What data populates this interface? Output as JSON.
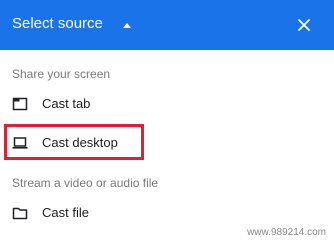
{
  "header": {
    "title": "Select source",
    "toggle_icon": "caret-up-icon",
    "close_icon": "close-icon"
  },
  "sections": [
    {
      "label": "Share your screen",
      "items": [
        {
          "label": "Cast tab",
          "icon": "tab-icon"
        },
        {
          "label": "Cast desktop",
          "icon": "laptop-icon",
          "highlighted": true
        }
      ]
    },
    {
      "label": "Stream a video or audio file",
      "items": [
        {
          "label": "Cast file",
          "icon": "folder-icon"
        }
      ]
    }
  ],
  "watermark": "www.989214.com",
  "colors": {
    "header_bg": "#1a73e8",
    "highlight_border": "#e02030"
  }
}
